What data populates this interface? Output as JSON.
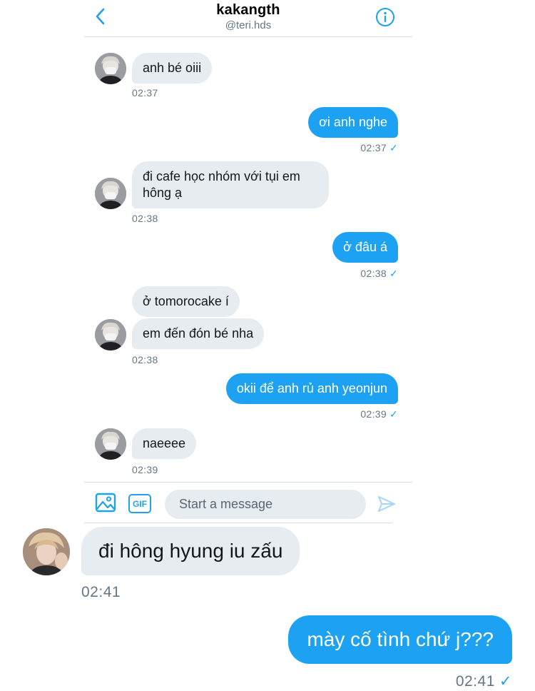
{
  "header": {
    "title": "kakangth",
    "subtitle": "@teri.hds",
    "back_icon": "chevron-left-icon",
    "info_icon": "info-icon"
  },
  "messages": [
    {
      "side": "left",
      "text": "anh bé oiii",
      "time": "02:37"
    },
    {
      "side": "right",
      "text": "ơi anh nghe",
      "time": "02:37"
    },
    {
      "side": "left",
      "text_line1": "đi cafe học nhóm với tụi em",
      "text_line2": "hông ạ",
      "time": "02:38"
    },
    {
      "side": "right",
      "text": "ở đâu á",
      "time": "02:38"
    },
    {
      "side": "left",
      "text": "ở tomorocake í"
    },
    {
      "side": "left",
      "text": "em đến đón bé nha",
      "time": "02:38"
    },
    {
      "side": "right",
      "text": "okii để anh rủ anh yeonjun",
      "time": "02:39"
    },
    {
      "side": "left",
      "text": "naeeee",
      "time": "02:39"
    }
  ],
  "composer": {
    "placeholder": "Start a message",
    "gif_label": "GIF"
  },
  "big_chat": [
    {
      "side": "left",
      "text": "đi hông hyung iu zấu",
      "time": "02:41"
    },
    {
      "side": "right",
      "text": "mày cố tình chứ j???",
      "time": "02:41"
    }
  ],
  "colors": {
    "accent": "#1da1f2",
    "bubble_gray": "#e6ecf0",
    "meta_text": "#657786"
  }
}
